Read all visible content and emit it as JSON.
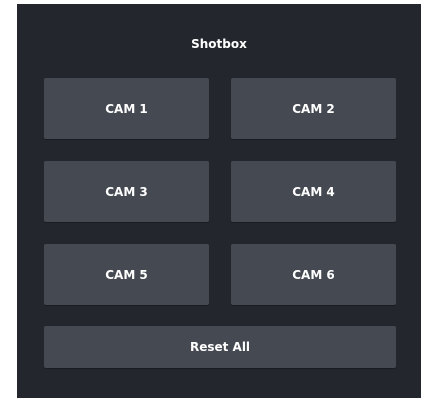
{
  "panel": {
    "title": "Shotbox",
    "buttons": [
      {
        "label": "CAM 1"
      },
      {
        "label": "CAM 2"
      },
      {
        "label": "CAM 3"
      },
      {
        "label": "CAM 4"
      },
      {
        "label": "CAM 5"
      },
      {
        "label": "CAM 6"
      }
    ],
    "reset_label": "Reset All"
  },
  "colors": {
    "background": "#23262c",
    "button": "#454951",
    "text": "#ffffff"
  }
}
